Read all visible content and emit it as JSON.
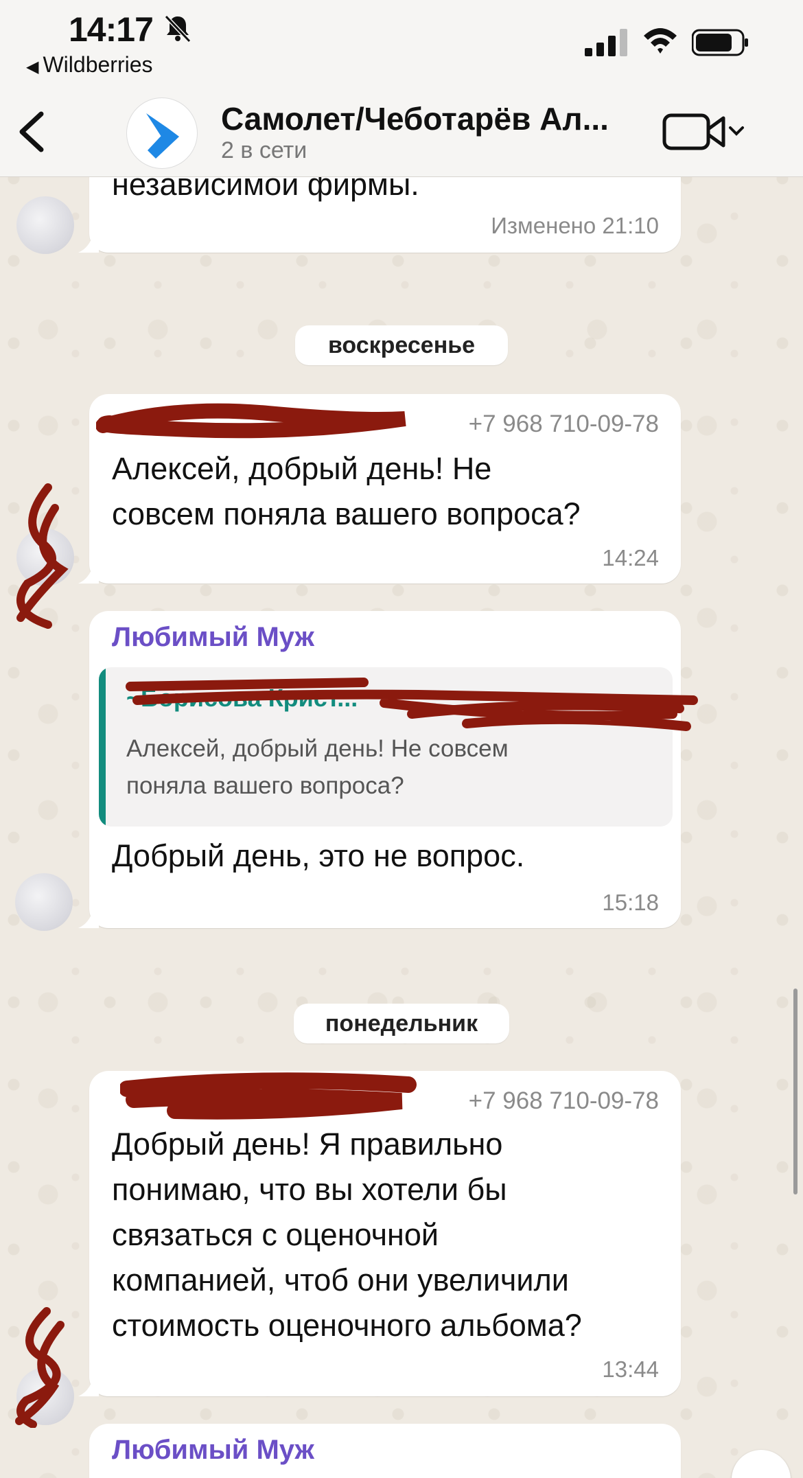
{
  "status_bar": {
    "time": "14:17",
    "back_app": "Wildberries"
  },
  "header": {
    "title": "Самолет/Чеботарёв Ал...",
    "subtitle": "2 в сети"
  },
  "messages": [
    {
      "id": "m0",
      "text": "независимой фирмы.",
      "time": "Изменено 21:10"
    },
    {
      "id": "m1",
      "sender_phone": "+7 968 710-09-78",
      "text_lines": [
        "Алексей, добрый день! Не",
        "совсем поняла вашего вопроса?"
      ],
      "time": "14:24"
    },
    {
      "id": "m2",
      "sender_name": "Любимый Муж",
      "quote": {
        "name": "~Борисова Крист...",
        "text_lines": [
          "Алексей, добрый день! Не совсем",
          "поняла вашего вопроса?"
        ]
      },
      "text": "Добрый день, это не вопрос.",
      "time": "15:18"
    },
    {
      "id": "m3",
      "sender_phone": "+7 968 710-09-78",
      "text_lines": [
        "Добрый день! Я правильно",
        "понимаю, что вы хотели бы",
        "связаться с оценочной",
        "компанией, чтоб они увеличили",
        "стоимость оценочного альбома?"
      ],
      "time": "13:44"
    },
    {
      "id": "m4",
      "sender_name": "Любимый Муж"
    }
  ],
  "date_separators": [
    "воскресенье",
    "понедельник"
  ],
  "colors": {
    "sender_name": "#6b4fc6",
    "quote_accent": "#128c7e",
    "redaction": "#8b1a0e",
    "wallpaper": "#efeae2"
  },
  "icons": [
    "bell-slash-icon",
    "signal-icon",
    "wifi-icon",
    "battery-icon",
    "back-chevron-icon",
    "video-call-icon",
    "scroll-down-icon"
  ]
}
